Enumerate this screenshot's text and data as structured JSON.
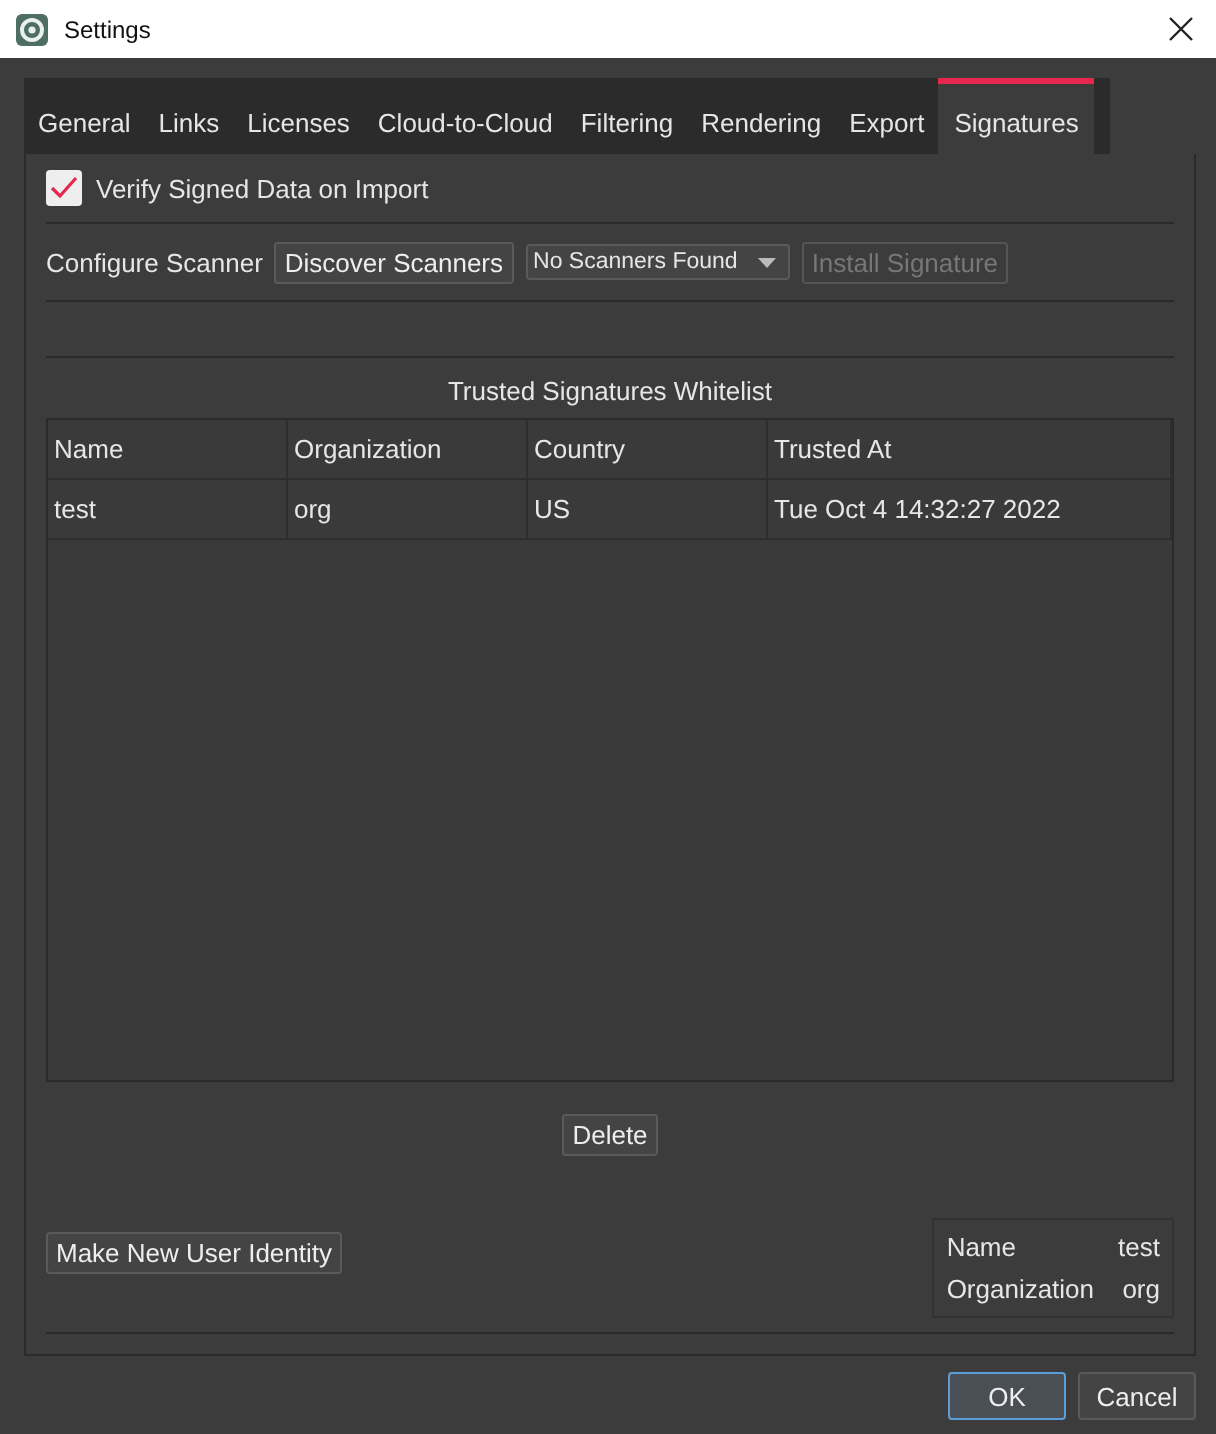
{
  "window": {
    "title": "Settings"
  },
  "tabs": [
    {
      "label": "General",
      "selected": false
    },
    {
      "label": "Links",
      "selected": false
    },
    {
      "label": "Licenses",
      "selected": false
    },
    {
      "label": "Cloud-to-Cloud",
      "selected": false
    },
    {
      "label": "Filtering",
      "selected": false
    },
    {
      "label": "Rendering",
      "selected": false
    },
    {
      "label": "Export",
      "selected": false
    },
    {
      "label": "Signatures",
      "selected": true
    }
  ],
  "verify": {
    "label": "Verify Signed Data on Import",
    "checked": true
  },
  "scanner": {
    "label": "Configure Scanner",
    "discover_button": "Discover Scanners",
    "dropdown": "No Scanners Found",
    "install_button": {
      "label": "Install Signature",
      "disabled": true
    }
  },
  "whitelist": {
    "title": "Trusted Signatures Whitelist",
    "columns": [
      "Name",
      "Organization",
      "Country",
      "Trusted At"
    ],
    "rows": [
      [
        "test",
        "org",
        "US",
        "Tue Oct  4 14:32:27 2022"
      ]
    ]
  },
  "delete_button": "Delete",
  "new_identity_button": "Make New User Identity",
  "identity": [
    {
      "label": "Name",
      "value": "test"
    },
    {
      "label": "Organization",
      "value": "org"
    }
  ],
  "buttons": [
    {
      "label": "OK",
      "kind": "default"
    },
    {
      "label": "Cancel",
      "kind": "normal"
    }
  ]
}
